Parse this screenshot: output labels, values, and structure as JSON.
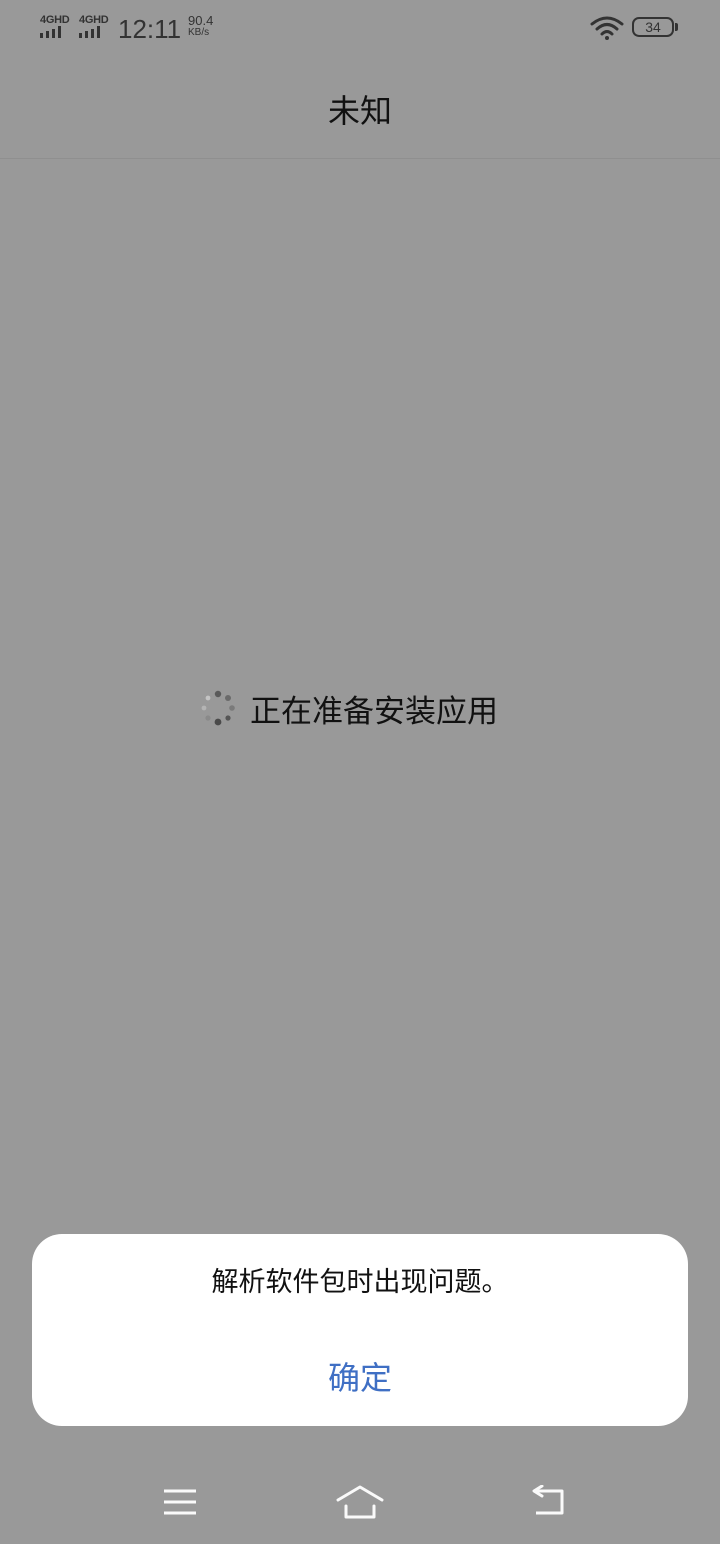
{
  "status_bar": {
    "sim1_label": "4GHD",
    "sim2_label": "4GHD",
    "time": "12:11",
    "net_speed_value": "90.4",
    "net_speed_unit": "KB/s",
    "battery_level": "34",
    "icons": [
      "signal-icon",
      "wifi-icon",
      "battery-icon"
    ]
  },
  "header": {
    "title": "未知"
  },
  "main": {
    "loading_text": "正在准备安装应用"
  },
  "dialog": {
    "message": "解析软件包时出现问题。",
    "confirm_label": "确定"
  },
  "nav_bar": {
    "icons": [
      "menu-icon",
      "home-icon",
      "back-icon"
    ]
  },
  "colors": {
    "background_dim": "#999999",
    "dialog_bg": "#ffffff",
    "accent": "#3f6fc4"
  }
}
